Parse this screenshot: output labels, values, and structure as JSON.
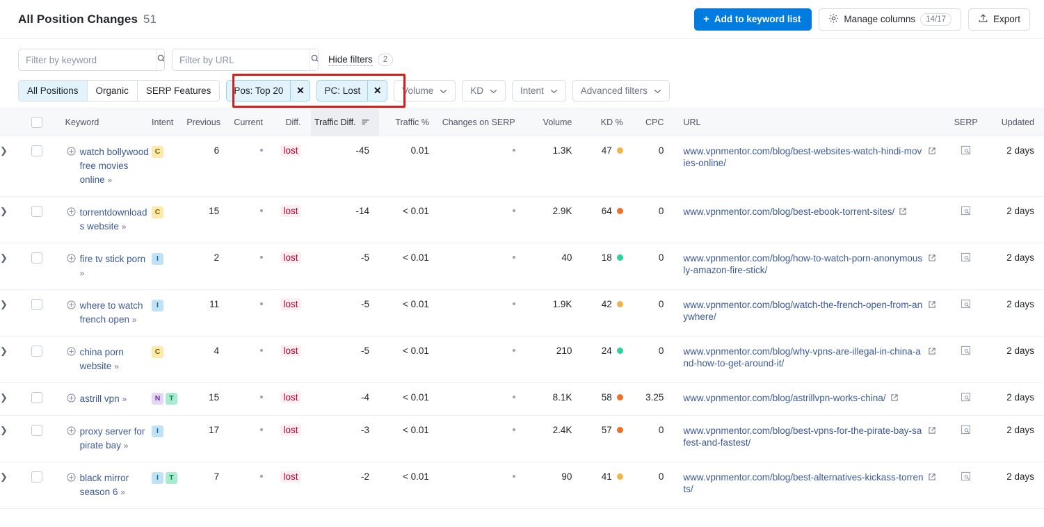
{
  "header": {
    "title": "All Position Changes",
    "count": "51",
    "add_to_keyword_list": "Add to keyword list",
    "manage_columns": "Manage columns",
    "manage_columns_count": "14/17",
    "export": "Export"
  },
  "filters": {
    "keyword_placeholder": "Filter by keyword",
    "keyword_value": "",
    "url_placeholder": "Filter by URL",
    "url_value": "",
    "hide_filters": "Hide filters",
    "hide_filters_count": "2",
    "segments": [
      {
        "label": "All Positions",
        "active": true
      },
      {
        "label": "Organic",
        "active": false
      },
      {
        "label": "SERP Features",
        "active": false
      }
    ],
    "chips": [
      {
        "label": "Pos: Top 20"
      },
      {
        "label": "PC: Lost"
      }
    ],
    "dropdowns": [
      "Volume",
      "KD",
      "Intent",
      "Advanced filters"
    ]
  },
  "table": {
    "columns": [
      "Keyword",
      "Intent",
      "Previous",
      "Current",
      "Diff.",
      "Traffic Diff.",
      "Traffic %",
      "Changes on SERP",
      "Volume",
      "KD %",
      "CPC",
      "URL",
      "SERP",
      "Updated"
    ],
    "sorted_column": "Traffic Diff.",
    "rows": [
      {
        "keyword": "watch bollywood free movies online",
        "intents": [
          "C"
        ],
        "previous": "6",
        "current": "•",
        "diff": "lost",
        "traffic_diff": "-45",
        "traffic_pct": "0.01",
        "changes_on_serp": "•",
        "volume": "1.3K",
        "kd": "47",
        "kd_color": "#f1b44c",
        "cpc": "0",
        "url": "www.vpnmentor.com/blog/best-websites-watch-hindi-movies-online/",
        "updated": "2 days"
      },
      {
        "keyword": "torrentdownloads website",
        "intents": [
          "C"
        ],
        "previous": "15",
        "current": "•",
        "diff": "lost",
        "traffic_diff": "-14",
        "traffic_pct": "< 0.01",
        "changes_on_serp": "•",
        "volume": "2.9K",
        "kd": "64",
        "kd_color": "#f0702a",
        "cpc": "0",
        "url": "www.vpnmentor.com/blog/best-ebook-torrent-sites/",
        "updated": "2 days"
      },
      {
        "keyword": "fire tv stick porn",
        "intents": [
          "I"
        ],
        "previous": "2",
        "current": "•",
        "diff": "lost",
        "traffic_diff": "-5",
        "traffic_pct": "< 0.01",
        "changes_on_serp": "•",
        "volume": "40",
        "kd": "18",
        "kd_color": "#2dd39a",
        "cpc": "0",
        "url": "www.vpnmentor.com/blog/how-to-watch-porn-anonymously-amazon-fire-stick/",
        "updated": "2 days"
      },
      {
        "keyword": "where to watch french open",
        "intents": [
          "I"
        ],
        "previous": "11",
        "current": "•",
        "diff": "lost",
        "traffic_diff": "-5",
        "traffic_pct": "< 0.01",
        "changes_on_serp": "•",
        "volume": "1.9K",
        "kd": "42",
        "kd_color": "#f1b44c",
        "cpc": "0",
        "url": "www.vpnmentor.com/blog/watch-the-french-open-from-anywhere/",
        "updated": "2 days"
      },
      {
        "keyword": "china porn website",
        "intents": [
          "C"
        ],
        "previous": "4",
        "current": "•",
        "diff": "lost",
        "traffic_diff": "-5",
        "traffic_pct": "< 0.01",
        "changes_on_serp": "•",
        "volume": "210",
        "kd": "24",
        "kd_color": "#2dd39a",
        "cpc": "0",
        "url": "www.vpnmentor.com/blog/why-vpns-are-illegal-in-china-and-how-to-get-around-it/",
        "updated": "2 days"
      },
      {
        "keyword": "astrill vpn",
        "intents": [
          "N",
          "T"
        ],
        "previous": "15",
        "current": "•",
        "diff": "lost",
        "traffic_diff": "-4",
        "traffic_pct": "< 0.01",
        "changes_on_serp": "•",
        "volume": "8.1K",
        "kd": "58",
        "kd_color": "#f0702a",
        "cpc": "3.25",
        "url": "www.vpnmentor.com/blog/astrillvpn-works-china/",
        "updated": "2 days"
      },
      {
        "keyword": "proxy server for pirate bay",
        "intents": [
          "I"
        ],
        "previous": "17",
        "current": "•",
        "diff": "lost",
        "traffic_diff": "-3",
        "traffic_pct": "< 0.01",
        "changes_on_serp": "•",
        "volume": "2.4K",
        "kd": "57",
        "kd_color": "#f0702a",
        "cpc": "0",
        "url": "www.vpnmentor.com/blog/best-vpns-for-the-pirate-bay-safest-and-fastest/",
        "updated": "2 days"
      },
      {
        "keyword": "black mirror season 6",
        "intents": [
          "I",
          "T"
        ],
        "previous": "7",
        "current": "•",
        "diff": "lost",
        "traffic_diff": "-2",
        "traffic_pct": "< 0.01",
        "changes_on_serp": "•",
        "volume": "90",
        "kd": "41",
        "kd_color": "#f1b44c",
        "cpc": "0",
        "url": "www.vpnmentor.com/blog/best-alternatives-kickass-torrents/",
        "updated": "2 days"
      }
    ]
  },
  "colors": {
    "primary": "#007be0",
    "chip_bg": "#e3f3fc",
    "chip_border": "#9ad3f0",
    "highlight_box": "#d02020",
    "lost_text": "#b3002e",
    "link": "#3c5a96"
  }
}
